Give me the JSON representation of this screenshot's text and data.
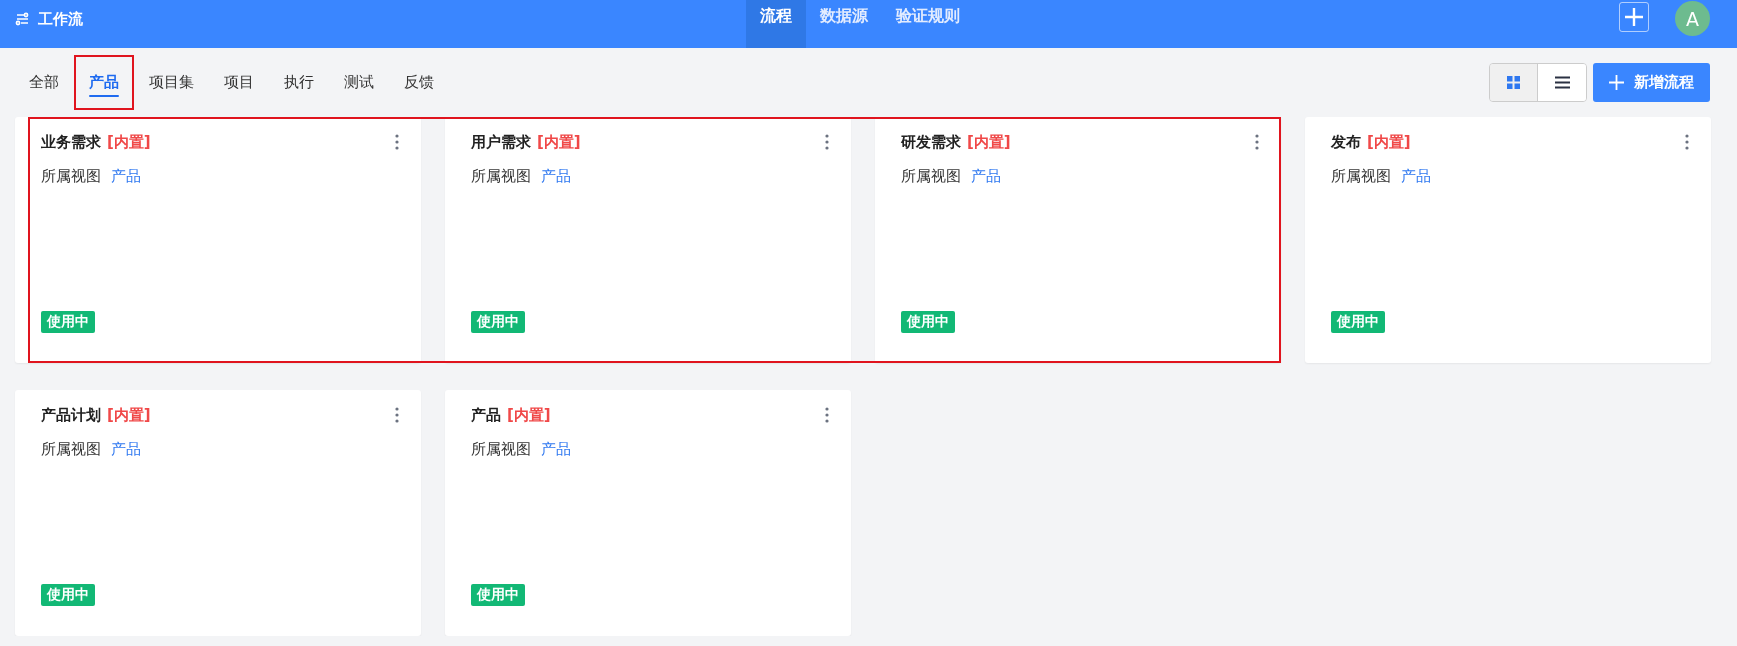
{
  "header": {
    "title": "工作流",
    "nav": [
      {
        "label": "流程",
        "selected": true
      },
      {
        "label": "数据源",
        "selected": false
      },
      {
        "label": "验证规则",
        "selected": false
      }
    ],
    "avatar": "A"
  },
  "tabs": [
    {
      "label": "全部",
      "selected": false,
      "outlined": false
    },
    {
      "label": "产品",
      "selected": true,
      "outlined": true
    },
    {
      "label": "项目集",
      "selected": false,
      "outlined": false
    },
    {
      "label": "项目",
      "selected": false,
      "outlined": false
    },
    {
      "label": "执行",
      "selected": false,
      "outlined": false
    },
    {
      "label": "测试",
      "selected": false,
      "outlined": false
    },
    {
      "label": "反馈",
      "selected": false,
      "outlined": false
    }
  ],
  "view_toggle": [
    {
      "kind": "grid",
      "selected": true
    },
    {
      "kind": "list",
      "selected": false
    }
  ],
  "new_button": "新增流程",
  "cards": [
    {
      "name": "业务需求",
      "tag": "[内置]",
      "view_label": "所属视图",
      "view": "产品",
      "status": "使用中",
      "outlined": true
    },
    {
      "name": "用户需求",
      "tag": "[内置]",
      "view_label": "所属视图",
      "view": "产品",
      "status": "使用中",
      "outlined": true
    },
    {
      "name": "研发需求",
      "tag": "[内置]",
      "view_label": "所属视图",
      "view": "产品",
      "status": "使用中",
      "outlined": true
    },
    {
      "name": "发布",
      "tag": "[内置]",
      "view_label": "所属视图",
      "view": "产品",
      "status": "使用中",
      "outlined": false
    },
    {
      "name": "产品计划",
      "tag": "[内置]",
      "view_label": "所属视图",
      "view": "产品",
      "status": "使用中",
      "outlined": false
    },
    {
      "name": "产品",
      "tag": "[内置]",
      "view_label": "所属视图",
      "view": "产品",
      "status": "使用中",
      "outlined": false
    }
  ]
}
